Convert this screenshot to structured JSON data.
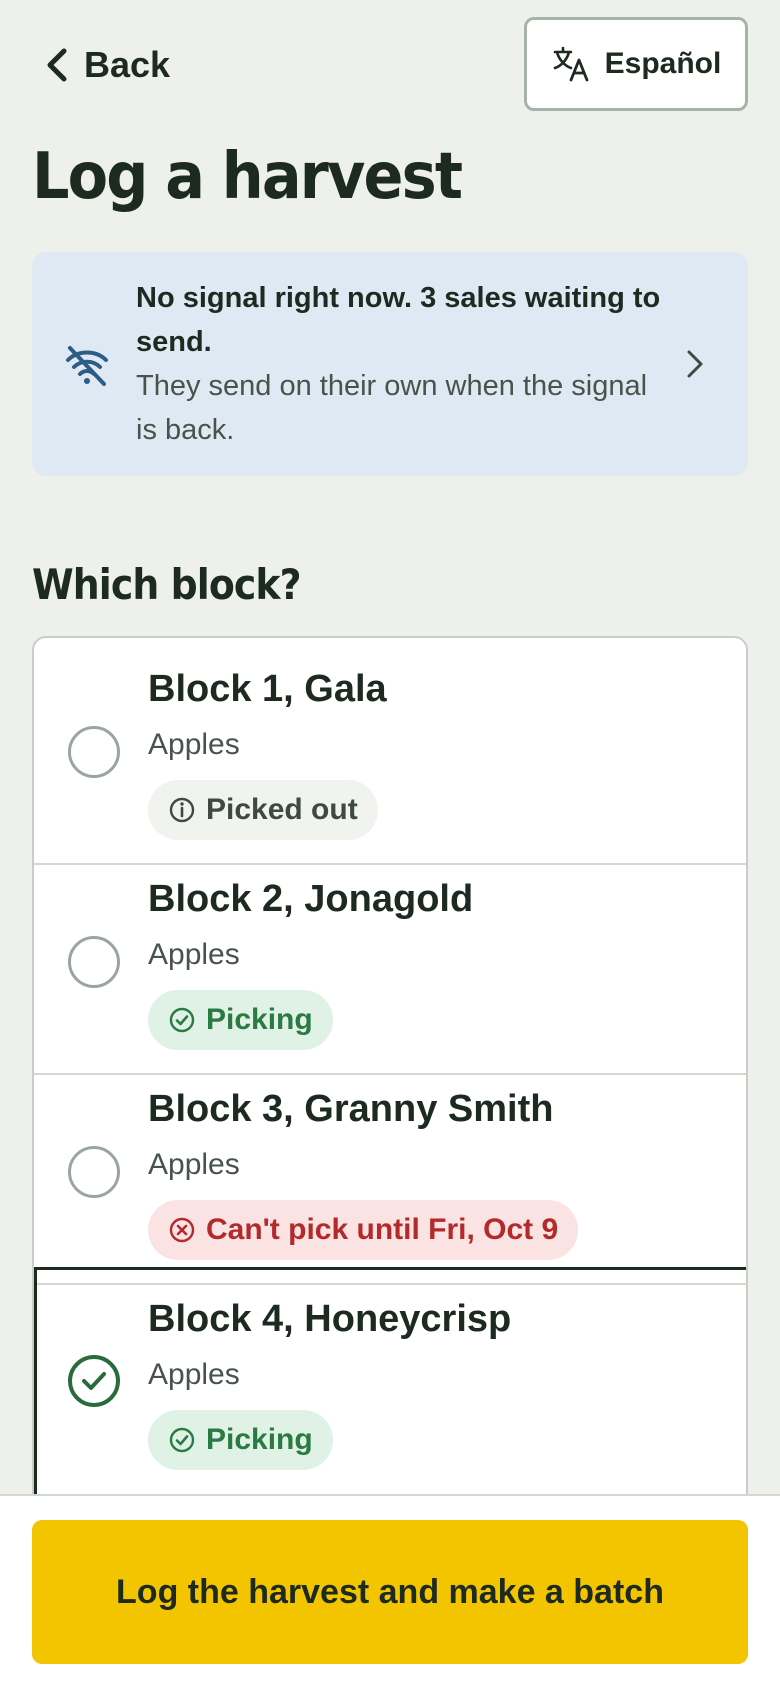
{
  "header": {
    "back_label": "Back",
    "language_label": "Español"
  },
  "page_title": "Log a harvest",
  "offline_banner": {
    "headline": "No signal right now. 3 sales waiting to send.",
    "detail": "They send on their own when the signal is back."
  },
  "block_question": "Which block?",
  "blocks": [
    {
      "name": "Block 1, Gala",
      "crop": "Apples",
      "status": "Picked out",
      "status_type": "info",
      "selected": false
    },
    {
      "name": "Block 2, Jonagold",
      "crop": "Apples",
      "status": "Picking",
      "status_type": "ok",
      "selected": false
    },
    {
      "name": "Block 3, Granny Smith",
      "crop": "Apples",
      "status": "Can't pick until Fri, Oct 9",
      "status_type": "bad",
      "selected": false
    },
    {
      "name": "Block 4, Honeycrisp",
      "crop": "Apples",
      "status": "Picking",
      "status_type": "ok",
      "selected": true
    }
  ],
  "primary_action": "Log the harvest and make a batch",
  "colors": {
    "background": "#eef0eb",
    "banner": "#dfe9f3",
    "cta": "#f2c500",
    "ok": "#2a7a42",
    "bad": "#b22a2a"
  }
}
